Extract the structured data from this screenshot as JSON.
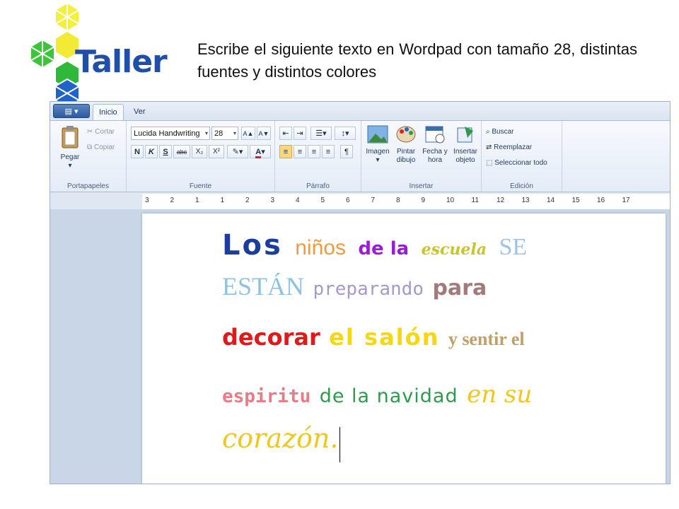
{
  "logo": {
    "text": "Taller"
  },
  "instruction": "Escribe el siguiente texto en Wordpad con tamaño 28, distintas fuentes y distintos colores",
  "wordpad": {
    "menu_button": "▤ ▾",
    "tabs": [
      {
        "label": "Inicio",
        "active": true
      },
      {
        "label": "Ver",
        "active": false
      }
    ],
    "groups": {
      "portapapeles": "Portapapeles",
      "fuente": "Fuente",
      "parrafo": "Párrafo",
      "insertar": "Insertar",
      "edicion": "Edición"
    },
    "clipboard": {
      "paste": "Pegar",
      "cut": "Cortar",
      "copy": "Copiar"
    },
    "font": {
      "name": "Lucida Handwriting",
      "size": "28",
      "bold": "N",
      "italic": "K",
      "underline": "S",
      "strike": "abc",
      "sub": "X₂",
      "sup": "X²",
      "grow": "A▲",
      "shrink": "A▼"
    },
    "insert": {
      "image": "Imagen",
      "paint": "Pintar dibujo",
      "datetime": "Fecha y hora",
      "object": "Insertar objeto"
    },
    "edit": {
      "find": "Buscar",
      "replace": "Reemplazar",
      "select_all": "Seleccionar todo"
    },
    "ruler_labels": [
      "3",
      "2",
      "1",
      "1",
      "2",
      "3",
      "4",
      "5",
      "6",
      "7",
      "8",
      "9",
      "10",
      "11",
      "12",
      "13",
      "14",
      "15",
      "16",
      "17"
    ]
  },
  "document": {
    "lines": [
      [
        {
          "text": "Los",
          "color": "#1a3f9a"
        },
        {
          "text": "niños",
          "color": "#f39a3c"
        },
        {
          "text": "de la",
          "color": "#9b1bd6"
        },
        {
          "text": "escuela",
          "color": "#c9c42a"
        },
        {
          "text": "SE",
          "color": "#9fc3e8"
        }
      ],
      [
        {
          "text": "ESTÁN",
          "color": "#8ec3e0"
        },
        {
          "text": "preparando",
          "color": "#a59ac8"
        },
        {
          "text": "para",
          "color": "#a27a7c"
        }
      ],
      [
        {
          "text": "decorar",
          "color": "#e01a1a"
        },
        {
          "text": "el salón",
          "color": "#f5d714"
        },
        {
          "text": "y sentir el",
          "color": "#c0a06a"
        }
      ],
      [
        {
          "text": "espiritu",
          "color": "#e97a86"
        },
        {
          "text": "de la navidad",
          "color": "#2e9b4a"
        },
        {
          "text": "en su",
          "color": "#f1c61f"
        }
      ],
      [
        {
          "text": "corazón.",
          "color": "#f1c61f"
        }
      ]
    ]
  }
}
